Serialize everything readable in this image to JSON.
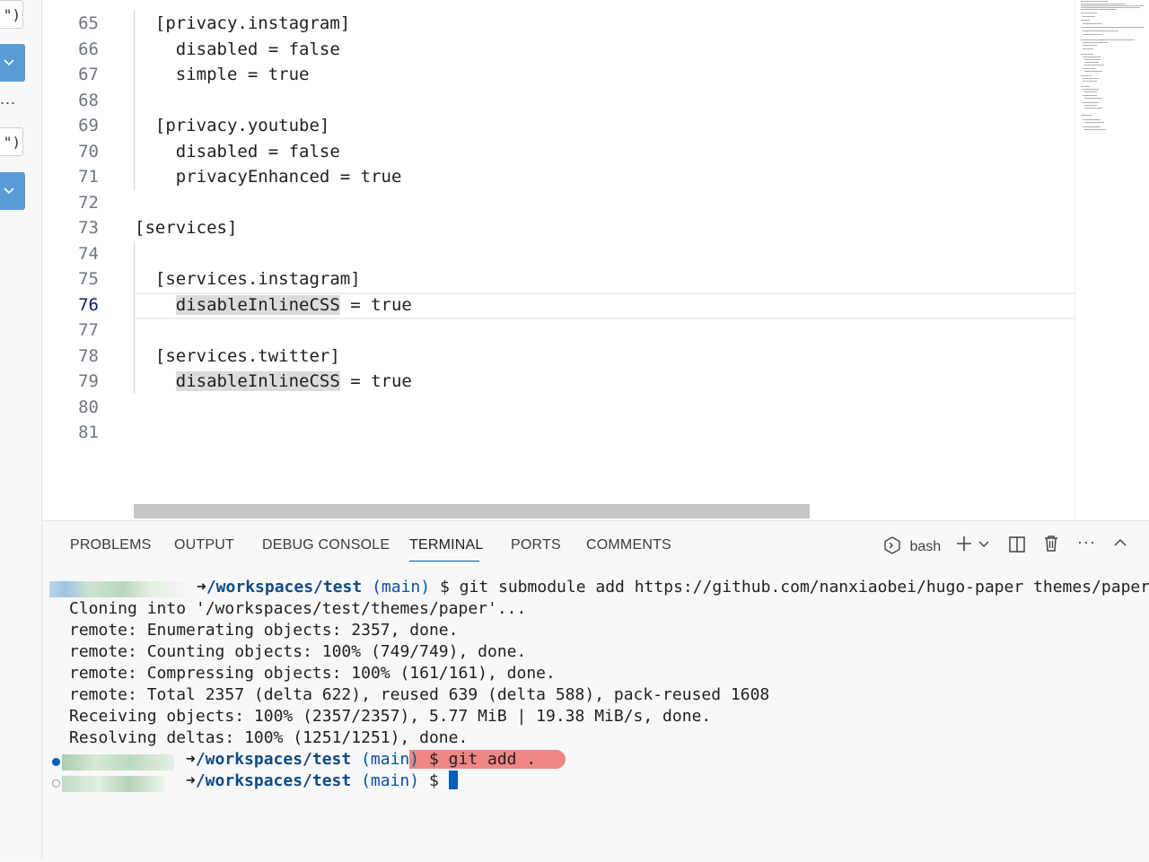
{
  "left_panel": {
    "input_suffix_1": "\")",
    "input_suffix_2": "\")",
    "more": "..."
  },
  "editor": {
    "lines": [
      {
        "num": "65",
        "text": "  [privacy.instagram]"
      },
      {
        "num": "66",
        "text": "    disabled = false"
      },
      {
        "num": "67",
        "text": "    simple = true"
      },
      {
        "num": "68",
        "text": ""
      },
      {
        "num": "69",
        "text": "  [privacy.youtube]"
      },
      {
        "num": "70",
        "text": "    disabled = false"
      },
      {
        "num": "71",
        "text": "    privacyEnhanced = true"
      },
      {
        "num": "72",
        "text": ""
      },
      {
        "num": "73",
        "text": "[services]"
      },
      {
        "num": "74",
        "text": ""
      },
      {
        "num": "75",
        "text": "  [services.instagram]"
      },
      {
        "num": "76",
        "text": "    disableInlineCSS = true",
        "key": "disableInlineCSS",
        "rest": " = true"
      },
      {
        "num": "77",
        "text": ""
      },
      {
        "num": "78",
        "text": "  [services.twitter]"
      },
      {
        "num": "79",
        "text": "    disableInlineCSS = true",
        "key": "disableInlineCSS",
        "rest": " = true"
      },
      {
        "num": "80",
        "text": ""
      },
      {
        "num": "81",
        "text": ""
      }
    ],
    "active_line": "76"
  },
  "panel": {
    "tabs": [
      {
        "id": "problems",
        "label": "PROBLEMS"
      },
      {
        "id": "output",
        "label": "OUTPUT"
      },
      {
        "id": "debug-console",
        "label": "DEBUG CONSOLE"
      },
      {
        "id": "terminal",
        "label": "TERMINAL"
      },
      {
        "id": "ports",
        "label": "PORTS"
      },
      {
        "id": "comments",
        "label": "COMMENTS"
      }
    ],
    "active_tab": "terminal",
    "shell_name": "bash",
    "more": "···"
  },
  "terminal": {
    "prompt_path": "/workspaces/test",
    "branch_open": "(",
    "branch": "main",
    "branch_close": ")",
    "prompt_symbol": "$",
    "cmd1": "git submodule add https://github.com/nanxiaobei/hugo-paper themes/paper",
    "output": [
      "Cloning into '/workspaces/test/themes/paper'...",
      "remote: Enumerating objects: 2357, done.",
      "remote: Counting objects: 100% (749/749), done.",
      "remote: Compressing objects: 100% (161/161), done.",
      "remote: Total 2357 (delta 622), reused 639 (delta 588), pack-reused 1608",
      "Receiving objects: 100% (2357/2357), 5.77 MiB | 19.38 MiB/s, done.",
      "Resolving deltas: 100% (1251/1251), done."
    ],
    "cmd2": "git add ."
  },
  "colors": {
    "accent": "#005fb8",
    "path": "#0f4a85",
    "highlight_cmd": "#f08686"
  }
}
